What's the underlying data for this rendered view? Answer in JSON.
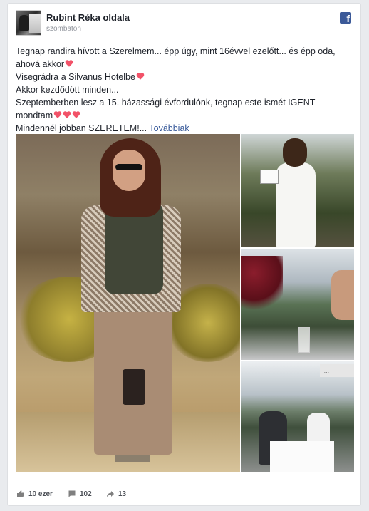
{
  "page": {
    "name": "Rubint Réka oldala",
    "time": "szombaton",
    "logo_icon": "facebook-icon",
    "accent": "#3b5998"
  },
  "post": {
    "lines": [
      "Tegnap randira hívott a Szerelmem... épp úgy, mint 16évvel ezelőtt... és épp oda,",
      "ahová akkor",
      "Visegrádra a Silvanus Hotelbe",
      "Akkor kezdődött minden...",
      "Szeptemberben lesz a 15. házassági évfordulónk, tegnap este ismét IGENT",
      "mondtam",
      "Mindennél jobban SZERETEM!..."
    ],
    "more_label": "Továbbiak",
    "heart_color": "#f25268"
  },
  "photos": [
    {
      "icon": "photo-main"
    },
    {
      "icon": "photo-right-1"
    },
    {
      "icon": "photo-right-2"
    },
    {
      "icon": "photo-right-3",
      "sign_text": "..."
    }
  ],
  "actions": {
    "likes": "10 ezer",
    "comments": "102",
    "shares": "13",
    "like_icon": "thumbs-up-icon",
    "comment_icon": "comment-icon",
    "share_icon": "share-icon"
  }
}
